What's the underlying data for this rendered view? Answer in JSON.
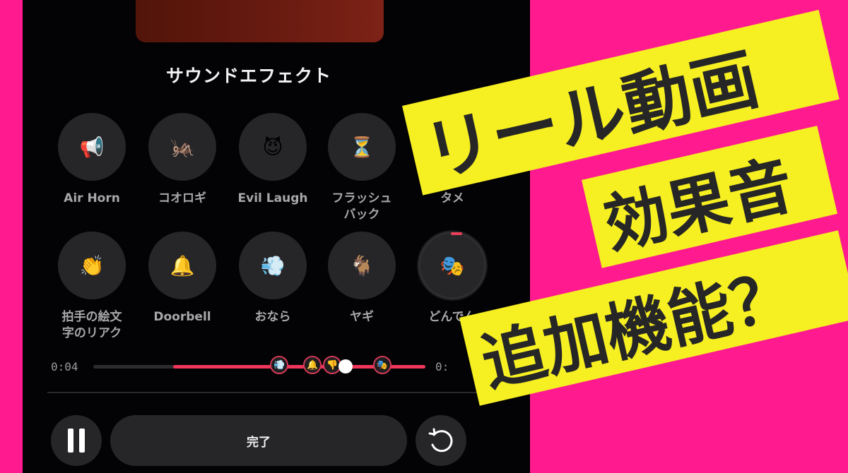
{
  "sheet": {
    "title": "サウンドエフェクト"
  },
  "effects_row1": [
    {
      "label": "Air Horn",
      "icon": "📢",
      "icon_name": "air-horn-icon"
    },
    {
      "label": "コオロギ",
      "icon": "🦗",
      "icon_name": "cricket-icon"
    },
    {
      "label": "Evil Laugh",
      "icon": "😈",
      "icon_name": "smiling-devil-icon"
    },
    {
      "label": "フラッシュ\nバック",
      "icon": "⏳",
      "icon_name": "hourglass-icon"
    },
    {
      "label": "タメ",
      "icon": "",
      "icon_name": "partially-hidden-icon"
    }
  ],
  "effects_row2": [
    {
      "label": "拍手の絵文\n字のリアク",
      "icon": "👏",
      "icon_name": "clapping-hands-icon"
    },
    {
      "label": "Doorbell",
      "icon": "🔔",
      "icon_name": "bell-icon"
    },
    {
      "label": "おなら",
      "icon": "💨",
      "icon_name": "puff-icon"
    },
    {
      "label": "ヤギ",
      "icon": "🐐",
      "icon_name": "goat-icon"
    },
    {
      "label": "どんでん",
      "icon": "🎭",
      "icon_name": "theater-masks-icon",
      "selected": true
    }
  ],
  "timeline": {
    "current_time": "0:04",
    "end_time": "0:",
    "played_fraction": 0.24,
    "playhead_fraction": 0.76,
    "markers": [
      {
        "icon": "💨",
        "name": "puff-marker",
        "fraction": 0.56
      },
      {
        "icon": "🔔",
        "name": "bell-marker",
        "fraction": 0.66
      },
      {
        "icon": "👎",
        "name": "thumbs-down-marker",
        "fraction": 0.72
      },
      {
        "icon": "🎭",
        "name": "theater-masks-marker",
        "fraction": 0.87
      }
    ],
    "colors": {
      "accent": "#f0365a",
      "track": "#2c2b2e"
    }
  },
  "controls": {
    "pause_icon": "pause",
    "done_label": "完了",
    "reset_icon": "undo"
  },
  "overlay": {
    "line1": "リール動画",
    "line2": "効果音",
    "line3": "追加機能？",
    "colors": {
      "background": "#ff1a8f",
      "banner": "#f6ef22",
      "text": "#262626"
    }
  }
}
